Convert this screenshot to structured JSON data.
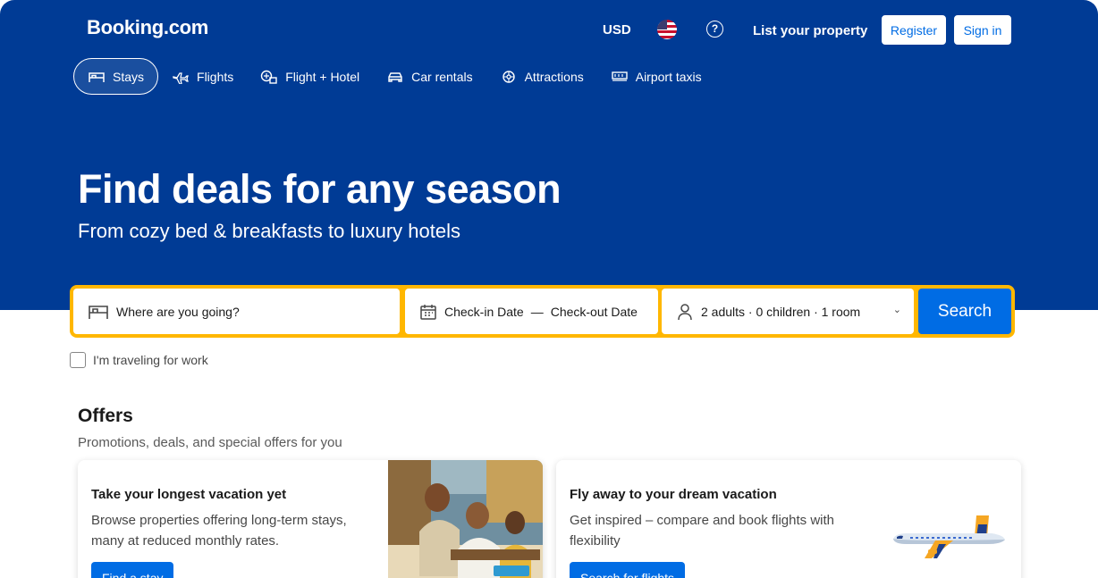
{
  "header": {
    "logo": "Booking.com",
    "currency": "USD",
    "list_property": "List your property",
    "register": "Register",
    "sign_in": "Sign in"
  },
  "nav": {
    "items": [
      {
        "label": "Stays",
        "icon": "bed-icon",
        "active": true
      },
      {
        "label": "Flights",
        "icon": "plane-icon"
      },
      {
        "label": "Flight + Hotel",
        "icon": "flight-hotel-icon"
      },
      {
        "label": "Car rentals",
        "icon": "car-icon"
      },
      {
        "label": "Attractions",
        "icon": "attractions-icon"
      },
      {
        "label": "Airport taxis",
        "icon": "taxi-icon"
      }
    ]
  },
  "hero": {
    "title": "Find deals for any season",
    "subtitle": "From cozy bed & breakfasts to luxury hotels"
  },
  "search": {
    "destination_placeholder": "Where are you going?",
    "checkin": "Check-in Date",
    "separator": "—",
    "checkout": "Check-out Date",
    "guests": "2 adults · 0 children · 1 room",
    "button": "Search",
    "work_label": "I'm traveling for work"
  },
  "offers": {
    "title": "Offers",
    "subtitle": "Promotions, deals, and special offers for you",
    "cards": [
      {
        "title": "Take your longest vacation yet",
        "body": "Browse properties offering long-term stays, many at reduced monthly rates.",
        "button": "Find a stay"
      },
      {
        "title": "Fly away to your dream vacation",
        "body": "Get inspired – compare and book flights with flexibility",
        "button": "Search for flights"
      }
    ]
  },
  "colors": {
    "brand_blue": "#003b95",
    "action_blue": "#006ce4",
    "search_border": "#ffb700"
  }
}
